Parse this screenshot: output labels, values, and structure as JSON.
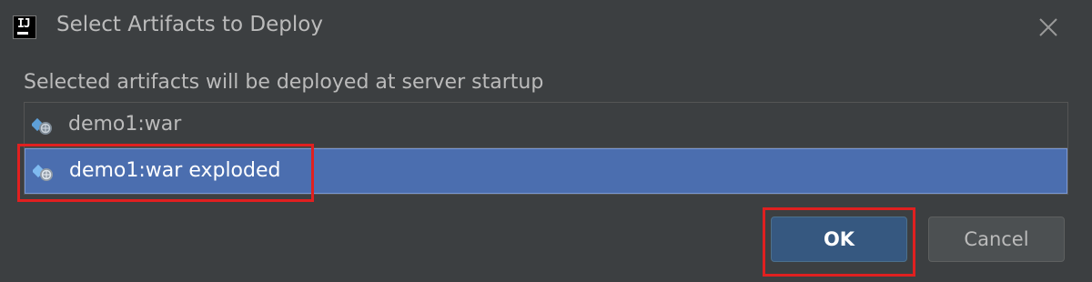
{
  "window": {
    "title": "Select Artifacts to Deploy",
    "app_icon_text": "IJ"
  },
  "description": "Selected artifacts will be deployed at server startup",
  "artifacts": [
    {
      "label": "demo1:war",
      "selected": false,
      "icon": "artifact-web-icon"
    },
    {
      "label": "demo1:war exploded",
      "selected": true,
      "icon": "artifact-web-icon"
    }
  ],
  "buttons": {
    "ok_label": "OK",
    "cancel_label": "Cancel"
  },
  "colors": {
    "background": "#3c3f41",
    "selection": "#4b6eaf",
    "ok_button": "#365880",
    "annotation": "#e02020"
  }
}
